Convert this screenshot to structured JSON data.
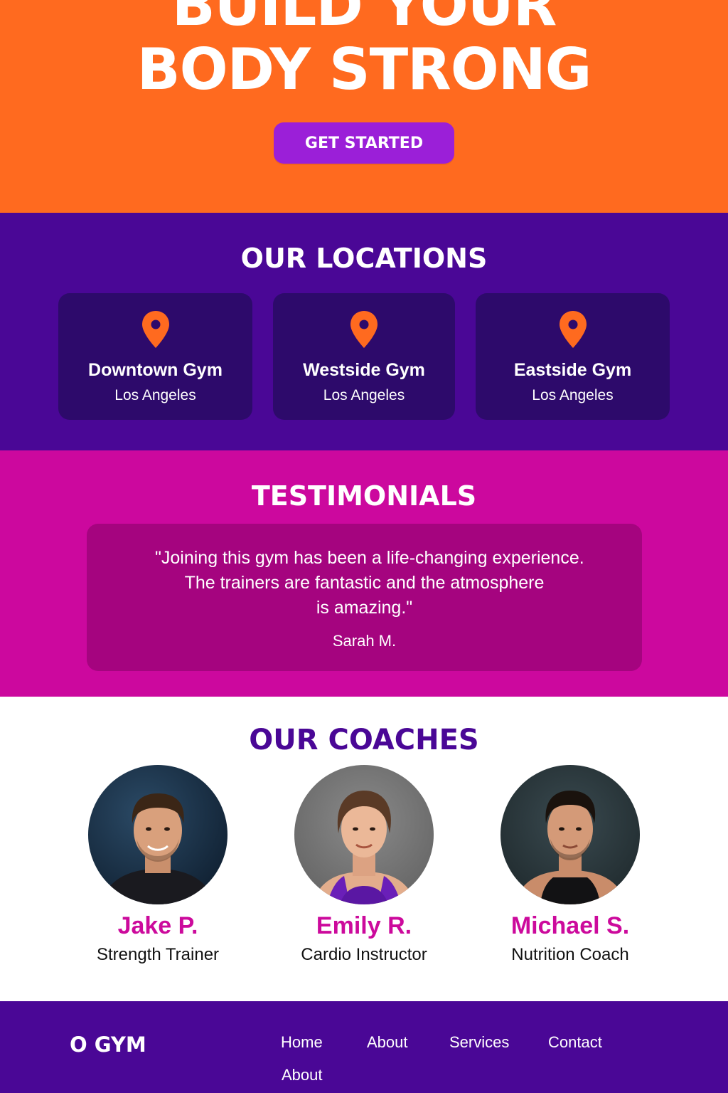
{
  "hero": {
    "title_line1": "BUILD YOUR",
    "title_line2": "BODY STRONG",
    "cta_label": "GET STARTED",
    "bg_color": "#ff6a1f",
    "cta_color": "#9b1fd8"
  },
  "locations": {
    "title": "OUR LOCATIONS",
    "bg_color": "#4a0796",
    "card_color": "#2d0a6b",
    "pin_color": "#ff6a1f",
    "items": [
      {
        "name": "Downtown Gym",
        "city": "Los Angeles",
        "icon": "map-pin-icon"
      },
      {
        "name": "Westside Gym",
        "city": "Los Angeles",
        "icon": "map-pin-icon"
      },
      {
        "name": "Eastside Gym",
        "city": "Los Angeles",
        "icon": "map-pin-icon"
      }
    ]
  },
  "testimonials": {
    "title": "TESTIMONIALS",
    "bg_color": "#cc089e",
    "quote_lines": [
      "\"Joining this gym has been a life-changing experience.",
      "The trainers are fantastic and the atmosphere",
      "is amazing.\""
    ],
    "author": "Sarah M."
  },
  "coaches": {
    "title": "OUR COACHES",
    "title_color": "#4a0796",
    "name_color": "#cc0a9c",
    "items": [
      {
        "name": "Jake P.",
        "role": "Strength Trainer"
      },
      {
        "name": "Emily R.",
        "role": "Cardio Instructor"
      },
      {
        "name": "Michael S.",
        "role": "Nutrition Coach"
      }
    ]
  },
  "footer": {
    "brand": "O GYM",
    "nav": [
      "Home",
      "About",
      "Services",
      "Contact",
      "About"
    ]
  }
}
